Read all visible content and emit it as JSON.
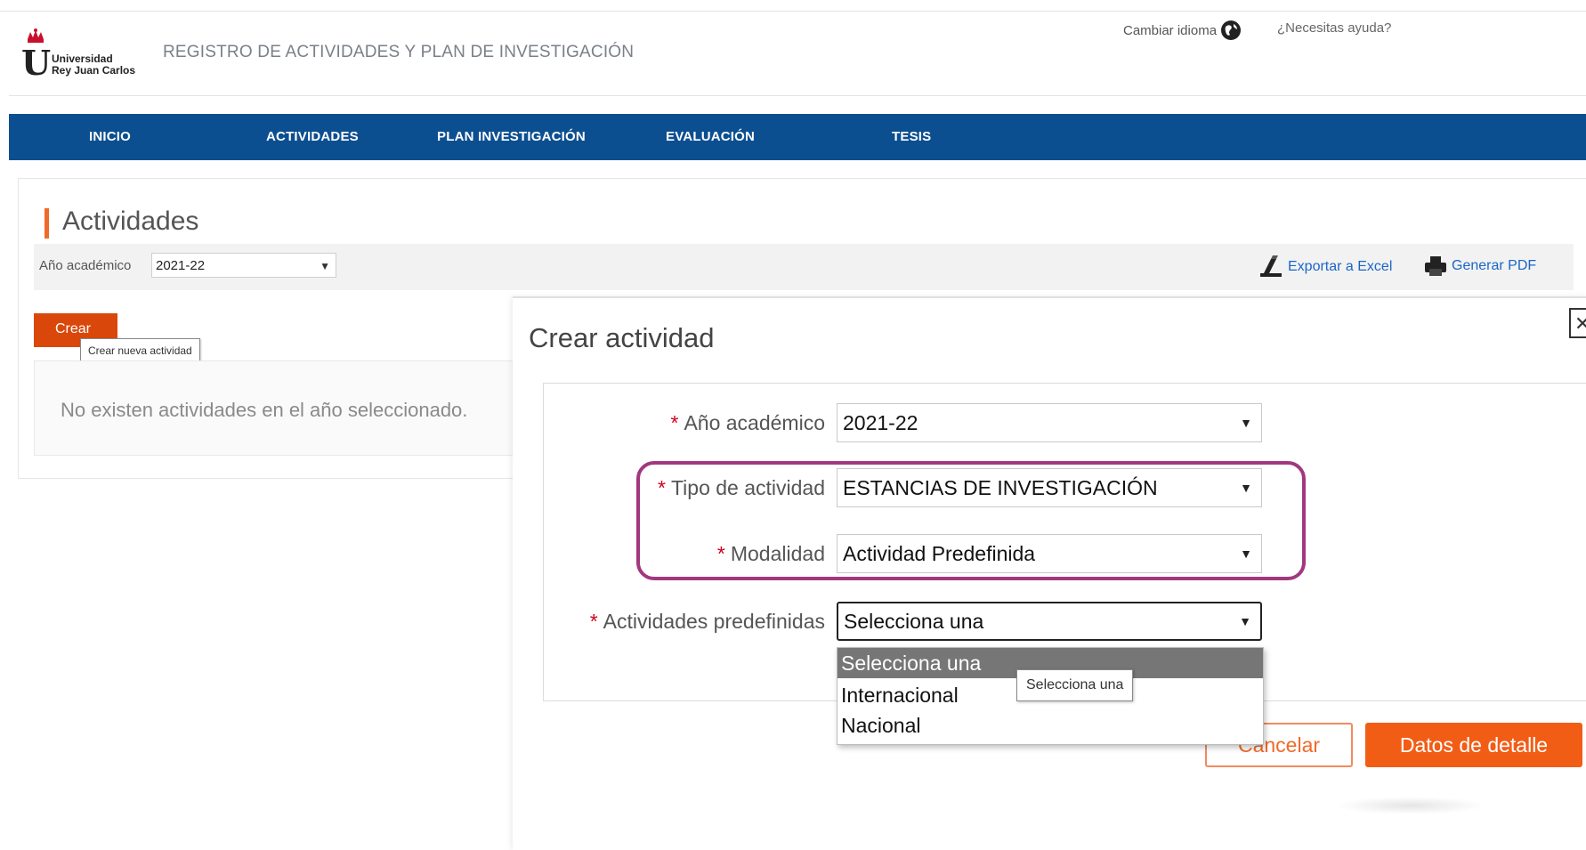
{
  "header": {
    "logo_line1": "Universidad",
    "logo_line2": "Rey Juan Carlos",
    "app_title": "REGISTRO DE ACTIVIDADES Y PLAN DE INVESTIGACIÓN",
    "change_language": "Cambiar idioma",
    "help": "¿Necesitas ayuda?"
  },
  "nav": {
    "items": [
      {
        "label": "INICIO"
      },
      {
        "label": "ACTIVIDADES"
      },
      {
        "label": "PLAN INVESTIGACIÓN"
      },
      {
        "label": "EVALUACIÓN"
      },
      {
        "label": "TESIS"
      }
    ]
  },
  "page": {
    "title": "Actividades",
    "year_label": "Año académico",
    "year_value": "2021-22",
    "export_excel": "Exportar a Excel",
    "generate_pdf": "Generar PDF",
    "create_button": "Crear",
    "create_tooltip": "Crear nueva actividad",
    "empty_message": "No existen actividades en el año seleccionado."
  },
  "modal": {
    "title": "Crear actividad",
    "close_glyph": "✕",
    "fields": [
      {
        "label": "Año académico",
        "required": "*",
        "value": "2021-22"
      },
      {
        "label": "Tipo de actividad",
        "required": "*",
        "value": "ESTANCIAS DE INVESTIGACIÓN"
      },
      {
        "label": "Modalidad",
        "required": "*",
        "value": "Actividad Predefinida"
      },
      {
        "label": "Actividades predefinidas",
        "required": "*",
        "value": "Selecciona una"
      }
    ],
    "dropdown_options": [
      {
        "label": "Selecciona una",
        "selected": true
      },
      {
        "label": "Internacional",
        "selected": false
      },
      {
        "label": "Nacional",
        "selected": false
      }
    ],
    "dropdown_tooltip": "Selecciona una",
    "cancel_button": "Cancelar",
    "detail_button": "Datos de detalle"
  },
  "icons": {
    "language": "globe-icon",
    "excel": "excel-export-icon",
    "pdf": "printer-icon",
    "select_arrow": "chevron-down-icon",
    "logo": "crown-icon"
  },
  "colors": {
    "nav_background": "#0c4f91",
    "accent_orange": "#f25d16",
    "create_button": "#d9480a",
    "highlight_border": "#a1387f",
    "link_blue": "#1a66c7",
    "required_red": "#d0021b"
  }
}
